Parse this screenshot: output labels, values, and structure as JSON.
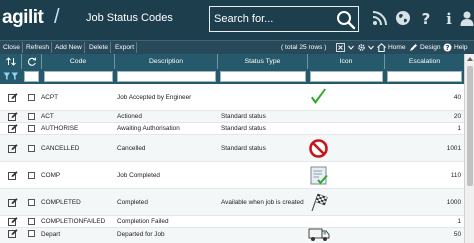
{
  "header": {
    "logo": "agilit",
    "logo_slash": "/",
    "title": "Job Status Codes",
    "search_placeholder": "Search for..."
  },
  "toolbar": {
    "close": "Close",
    "refresh": "Refresh",
    "add_new": "Add New",
    "delete": "Delete",
    "export": "Export",
    "row_count": "( total 25 rows )",
    "home": "Home",
    "design": "Design",
    "help": "Help"
  },
  "grid": {
    "columns": [
      "Code",
      "Description",
      "Status Type",
      "Icon",
      "Escalation"
    ],
    "rows": [
      {
        "code": "ACPT",
        "description": "Job Accepted by Engineer",
        "status_type": "",
        "icon": "green-checkmark-icon",
        "escalation": "40"
      },
      {
        "code": "ACT",
        "description": "Actioned",
        "status_type": "Standard status",
        "icon": "",
        "escalation": "20"
      },
      {
        "code": "AUTHORISE",
        "description": "Awaiting Authorisation",
        "status_type": "Standard status",
        "icon": "",
        "escalation": "1"
      },
      {
        "code": "CANCELLED",
        "description": "Cancelled",
        "status_type": "Standard status",
        "icon": "no-entry-icon",
        "escalation": "1001"
      },
      {
        "code": "COMP",
        "description": "Job Completed",
        "status_type": "",
        "icon": "completed-document-icon",
        "escalation": "110"
      },
      {
        "code": "COMPLETED",
        "description": "Completed",
        "status_type": "Available when job is created",
        "icon": "checkered-flag-icon",
        "escalation": "1000"
      },
      {
        "code": "COMPLETIONFAILED",
        "description": "Completion Failed",
        "status_type": "",
        "icon": "",
        "escalation": "1"
      },
      {
        "code": "Depart",
        "description": "Departed for Job",
        "status_type": "",
        "icon": "delivery-van-icon",
        "escalation": "50"
      }
    ]
  }
}
